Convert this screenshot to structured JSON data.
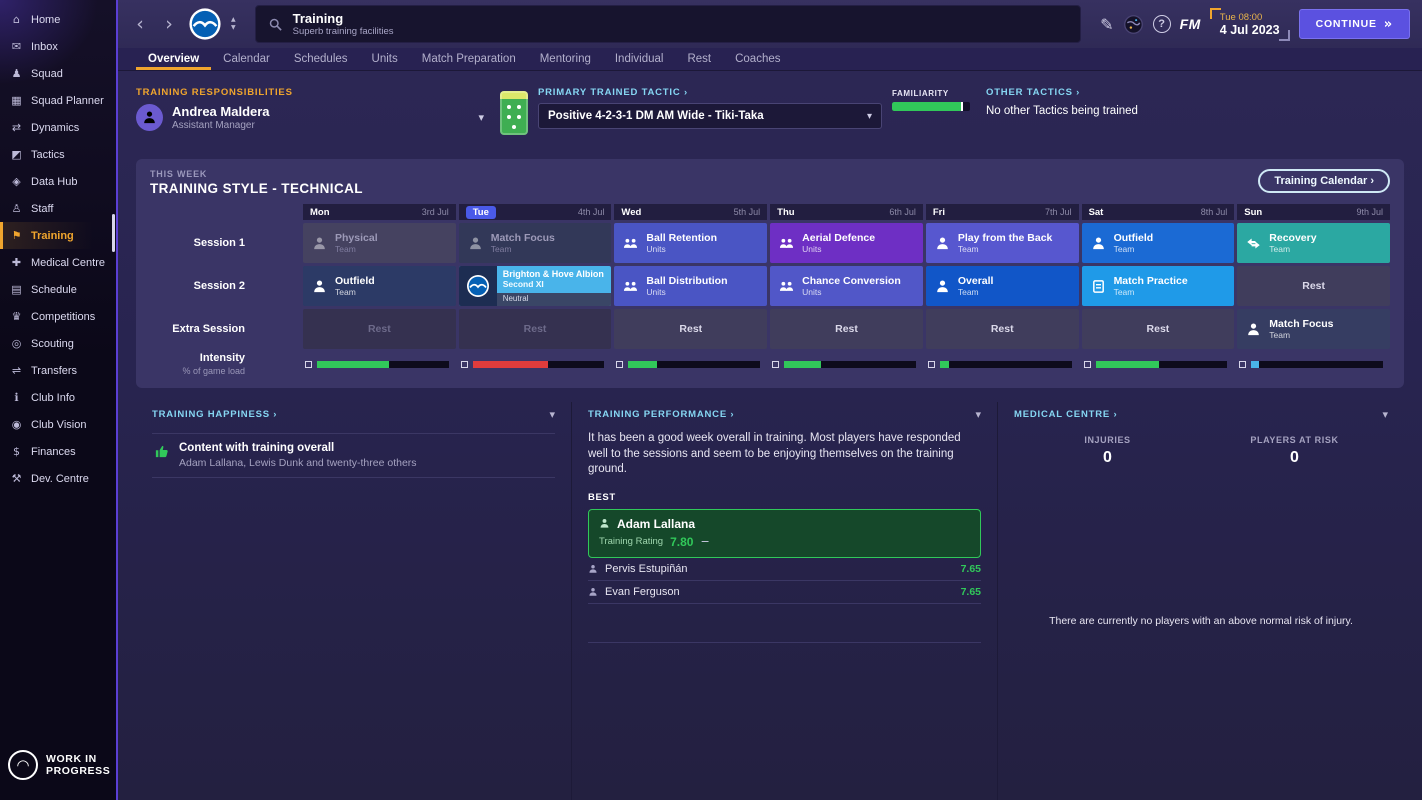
{
  "colors": {
    "accent_orange": "#f0a52e",
    "accent_light_blue": "#86d7f3",
    "continue_purple": "#5b51e0",
    "positive_green": "#31c85a",
    "negative_red": "#e03c3c",
    "today_badge_blue": "#4a5ae8"
  },
  "sidebar": {
    "items": [
      {
        "label": "Home",
        "icon": "home-icon",
        "glyph": "⌂"
      },
      {
        "label": "Inbox",
        "icon": "inbox-icon",
        "glyph": "✉"
      },
      {
        "label": "Squad",
        "icon": "squad-icon",
        "glyph": "♟"
      },
      {
        "label": "Squad Planner",
        "icon": "squad-planner-icon",
        "glyph": "▦"
      },
      {
        "label": "Dynamics",
        "icon": "dynamics-icon",
        "glyph": "⇄"
      },
      {
        "label": "Tactics",
        "icon": "tactics-icon",
        "glyph": "◩"
      },
      {
        "label": "Data Hub",
        "icon": "data-hub-icon",
        "glyph": "◈"
      },
      {
        "label": "Staff",
        "icon": "staff-icon",
        "glyph": "♙"
      },
      {
        "label": "Training",
        "icon": "training-icon",
        "glyph": "⚑"
      },
      {
        "label": "Medical Centre",
        "icon": "medical-centre-icon",
        "glyph": "✚"
      },
      {
        "label": "Schedule",
        "icon": "schedule-icon",
        "glyph": "▤"
      },
      {
        "label": "Competitions",
        "icon": "competitions-icon",
        "glyph": "♛"
      },
      {
        "label": "Scouting",
        "icon": "scouting-icon",
        "glyph": "◎"
      },
      {
        "label": "Transfers",
        "icon": "transfers-icon",
        "glyph": "⇌"
      },
      {
        "label": "Club Info",
        "icon": "club-info-icon",
        "glyph": "ℹ"
      },
      {
        "label": "Club Vision",
        "icon": "club-vision-icon",
        "glyph": "◉"
      },
      {
        "label": "Finances",
        "icon": "finances-icon",
        "glyph": "$"
      },
      {
        "label": "Dev. Centre",
        "icon": "dev-centre-icon",
        "glyph": "⚒"
      }
    ],
    "footer_line1": "WORK IN",
    "footer_line2": "PROGRESS"
  },
  "topbar": {
    "back": "‹",
    "forward": "›",
    "title": "Training",
    "subtitle": "Superb training facilities",
    "pencil_glyph": "✎",
    "help_glyph": "?",
    "fm_logo": "FM",
    "day_time": "Tue 08:00",
    "date": "4 Jul 2023",
    "continue_label": "CONTINUE",
    "continue_glyph": "»"
  },
  "tabs": {
    "items": [
      "Overview",
      "Calendar",
      "Schedules",
      "Units",
      "Match Preparation",
      "Mentoring",
      "Individual",
      "Rest",
      "Coaches"
    ],
    "active": "Overview"
  },
  "responsibilities": {
    "label": "TRAINING RESPONSIBILITIES",
    "name": "Andrea Maldera",
    "role": "Assistant Manager",
    "chevron": "▾"
  },
  "tactic": {
    "label": "PRIMARY TRAINED TACTIC ›",
    "value": "Positive 4-2-3-1 DM AM Wide - Tiki-Taka",
    "chevron": "▾",
    "familiarity_label": "FAMILIARITY",
    "familiarity_fill": "88%",
    "familiarity_color": "#31c85a"
  },
  "other_tactics": {
    "label": "OTHER TACTICS ›",
    "value": "No other Tactics being trained"
  },
  "week": {
    "eyebrow": "THIS WEEK",
    "title": "TRAINING STYLE - TECHNICAL",
    "calendar_button": "Training Calendar ›",
    "days": [
      {
        "day": "Mon",
        "date": "3rd Jul"
      },
      {
        "day": "Tue",
        "date": "4th Jul",
        "today": true
      },
      {
        "day": "Wed",
        "date": "5th Jul"
      },
      {
        "day": "Thu",
        "date": "6th Jul"
      },
      {
        "day": "Fri",
        "date": "7th Jul"
      },
      {
        "day": "Sat",
        "date": "8th Jul"
      },
      {
        "day": "Sun",
        "date": "9th Jul"
      }
    ],
    "row_labels": [
      "Session 1",
      "Session 2",
      "Extra Session"
    ],
    "session1": [
      {
        "title": "Physical",
        "subtitle": "Team",
        "icon": "person-icon",
        "bg": "#454260"
      },
      {
        "title": "Match Focus",
        "subtitle": "Team",
        "icon": "person-icon",
        "bg": "#323858"
      },
      {
        "title": "Ball Retention",
        "subtitle": "Units",
        "icon": "units-icon",
        "bg": "#4a55c4"
      },
      {
        "title": "Aerial Defence",
        "subtitle": "Units",
        "icon": "units-icon",
        "bg": "#6e2fc4"
      },
      {
        "title": "Play from the Back",
        "subtitle": "Team",
        "icon": "person-icon",
        "bg": "#5757cf"
      },
      {
        "title": "Outfield",
        "subtitle": "Team",
        "icon": "person-icon",
        "bg": "#1b6ad4"
      },
      {
        "title": "Recovery",
        "subtitle": "Team",
        "icon": "recovery-icon",
        "bg": "#2ba8a2"
      }
    ],
    "session2": [
      {
        "title": "Outfield",
        "subtitle": "Team",
        "icon": "person-icon",
        "bg": "#2c3a66"
      },
      {
        "opponent": "Brighton & Hove Albion",
        "team": "Second XI",
        "venue": "Neutral",
        "bg": "#49b4ea"
      },
      {
        "title": "Ball Distribution",
        "subtitle": "Units",
        "icon": "units-icon",
        "bg": "#4a55c4"
      },
      {
        "title": "Chance Conversion",
        "subtitle": "Units",
        "icon": "units-icon",
        "bg": "#5157c8"
      },
      {
        "title": "Overall",
        "subtitle": "Team",
        "icon": "person-icon",
        "bg": "#1156c8"
      },
      {
        "title": "Match Practice",
        "subtitle": "Team",
        "icon": "board-icon",
        "bg": "#1f9ae8"
      },
      {
        "title": "Rest",
        "bg": "#403d5c"
      }
    ],
    "extra": [
      {
        "title": "Rest",
        "dim": true
      },
      {
        "title": "Rest",
        "dim": true
      },
      {
        "title": "Rest"
      },
      {
        "title": "Rest"
      },
      {
        "title": "Rest"
      },
      {
        "title": "Rest"
      },
      {
        "title": "Match Focus",
        "subtitle": "Team",
        "icon": "person-icon",
        "bg": "#363d62"
      }
    ],
    "intensity": {
      "label": "Intensity",
      "sublabel": "% of game load",
      "bars": [
        {
          "fill": "55%",
          "color": "#31c85a"
        },
        {
          "fill": "57%",
          "color": "#e03c3c"
        },
        {
          "fill": "22%",
          "color": "#31c85a"
        },
        {
          "fill": "28%",
          "color": "#31c85a"
        },
        {
          "fill": "7%",
          "color": "#31c85a"
        },
        {
          "fill": "48%",
          "color": "#31c85a"
        },
        {
          "fill": "6%",
          "color": "#49b4ea"
        }
      ]
    }
  },
  "happiness": {
    "label": "TRAINING HAPPINESS ›",
    "chevron": "▾",
    "item_title": "Content with training overall",
    "item_subtitle": "Adam Lallana, Lewis Dunk and twenty-three others"
  },
  "performance": {
    "label": "TRAINING PERFORMANCE ›",
    "chevron": "▾",
    "summary": "It has been a good week overall in training. Most players have responded well to the sessions and seem to be enjoying themselves on the training ground.",
    "best_label": "BEST",
    "best": {
      "name": "Adam Lallana",
      "rating_label": "Training Rating",
      "rating": "7.80",
      "trend": "−"
    },
    "others": [
      {
        "name": "Pervis Estupiñán",
        "rating": "7.65"
      },
      {
        "name": "Evan Ferguson",
        "rating": "7.65"
      }
    ]
  },
  "medical": {
    "label": "MEDICAL CENTRE ›",
    "chevron": "▾",
    "injuries_label": "INJURIES",
    "injuries_value": "0",
    "risk_label": "PLAYERS AT RISK",
    "risk_value": "0",
    "note": "There are currently no players with an above normal risk of injury."
  }
}
